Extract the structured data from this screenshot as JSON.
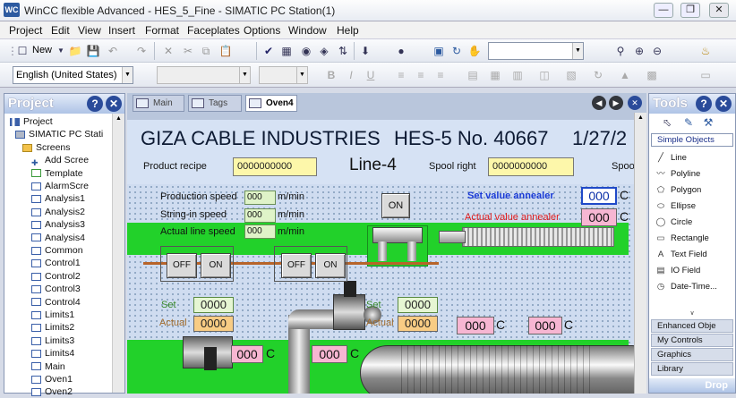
{
  "window": {
    "title": "WinCC flexible Advanced - HES_5_Fine - SIMATIC PC Station(1)",
    "icon": "wincc-app-icon",
    "buttons": [
      "minimize-icon",
      "restore-icon",
      "close-icon"
    ]
  },
  "menu": [
    "Project",
    "Edit",
    "View",
    "Insert",
    "Format",
    "Faceplates",
    "Options",
    "Window",
    "Help"
  ],
  "toolbar": {
    "new_label": "New",
    "language": "English (United States)"
  },
  "project": {
    "title": "Project",
    "tree": [
      {
        "label": "Project",
        "level": 0,
        "type": "project"
      },
      {
        "label": "SIMATIC PC Stati",
        "level": 1,
        "type": "station"
      },
      {
        "label": "Screens",
        "level": 2,
        "type": "folder"
      },
      {
        "label": "Add Scree",
        "level": 3,
        "type": "add"
      },
      {
        "label": "Template",
        "level": 3,
        "type": "template"
      },
      {
        "label": "AlarmScre",
        "level": 3,
        "type": "screen"
      },
      {
        "label": "Analysis1",
        "level": 3,
        "type": "screen"
      },
      {
        "label": "Analysis2",
        "level": 3,
        "type": "screen"
      },
      {
        "label": "Analysis3",
        "level": 3,
        "type": "screen"
      },
      {
        "label": "Analysis4",
        "level": 3,
        "type": "screen"
      },
      {
        "label": "Common",
        "level": 3,
        "type": "screen"
      },
      {
        "label": "Control1",
        "level": 3,
        "type": "screen"
      },
      {
        "label": "Control2",
        "level": 3,
        "type": "screen"
      },
      {
        "label": "Control3",
        "level": 3,
        "type": "screen"
      },
      {
        "label": "Control4",
        "level": 3,
        "type": "screen"
      },
      {
        "label": "Limits1",
        "level": 3,
        "type": "screen"
      },
      {
        "label": "Limits2",
        "level": 3,
        "type": "screen"
      },
      {
        "label": "Limits3",
        "level": 3,
        "type": "screen"
      },
      {
        "label": "Limits4",
        "level": 3,
        "type": "screen"
      },
      {
        "label": "Main",
        "level": 3,
        "type": "screen"
      },
      {
        "label": "Oven1",
        "level": 3,
        "type": "screen"
      },
      {
        "label": "Oven2",
        "level": 3,
        "type": "screen"
      }
    ]
  },
  "editor": {
    "tabs": [
      "Main",
      "Tags",
      "Oven4"
    ],
    "active_tab": "Oven4"
  },
  "hmi": {
    "company": "GIZA CABLE INDUSTRIES",
    "machine": "HES-5 No. 40667",
    "date": "1/27/2",
    "line": "Line-4",
    "product_recipe_label": "Product recipe",
    "product_recipe_value": "0000000000",
    "spool_right_label": "Spool right",
    "spool_right_value": "0000000000",
    "spool_cut_label": "Spoo",
    "production_speed_label": "Production speed",
    "production_speed_value": "000",
    "stringin_speed_label": "String-in speed",
    "stringin_speed_value": "000",
    "actual_line_speed_label": "Actual line speed",
    "actual_line_speed_value": "000",
    "unit_mmin": "m/min",
    "on_button": "ON",
    "set_annealer_label": "Set value annealer",
    "set_annealer_value": "000",
    "actual_annealer_label": "Actual value annealer",
    "actual_annealer_value": "000",
    "unit_c": "C",
    "off_label": "OFF",
    "on_label": "ON",
    "set_label": "Set",
    "actual_label": "Actual",
    "set1_value": "0000",
    "actual1_value": "0000",
    "set2_value": "0000",
    "actual2_value": "0000",
    "temp_a": "000",
    "temp_b": "000",
    "temp_c": "000",
    "temp_d": "000"
  },
  "tools": {
    "title": "Tools",
    "section": "Simple Objects",
    "items": [
      {
        "label": "Line",
        "icon": "line-icon"
      },
      {
        "label": "Polyline",
        "icon": "polyline-icon"
      },
      {
        "label": "Polygon",
        "icon": "polygon-icon"
      },
      {
        "label": "Ellipse",
        "icon": "ellipse-icon"
      },
      {
        "label": "Circle",
        "icon": "circle-icon"
      },
      {
        "label": "Rectangle",
        "icon": "rectangle-icon"
      },
      {
        "label": "Text Field",
        "icon": "text-field-icon"
      },
      {
        "label": "IO Field",
        "icon": "io-field-icon"
      },
      {
        "label": "Date-Time...",
        "icon": "date-time-icon"
      }
    ],
    "categories": [
      "Enhanced Obje",
      "My Controls",
      "Graphics",
      "Library"
    ],
    "drop": "Drop"
  },
  "colors": {
    "panel_header": "#aec3e6",
    "hmi_green": "#22d12a",
    "yellow_field": "#fdf7aa",
    "pink_field": "#f7b6d2",
    "orange_field": "#f8cc84"
  }
}
